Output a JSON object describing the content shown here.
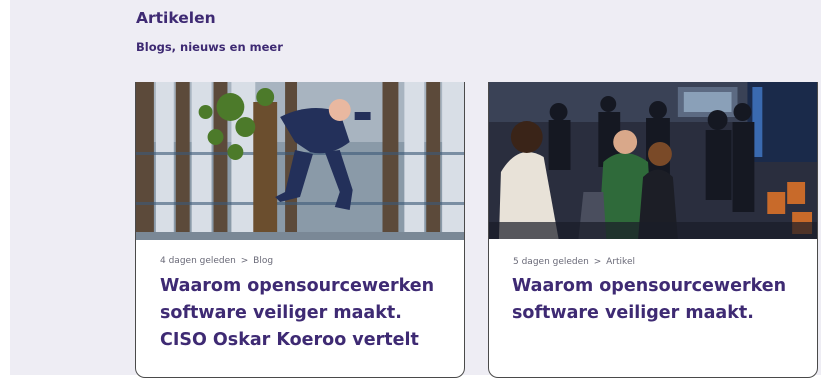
{
  "section": {
    "title": "Artikelen",
    "subtitle": "Blogs, nieuws en meer"
  },
  "cards": [
    {
      "date": "4 dagen geleden",
      "separator": ">",
      "category": "Blog",
      "title": "Waarom opensourcewerken software veiliger maakt. CISO Oskar Koeroo vertelt"
    },
    {
      "date": "5 dagen geleden",
      "separator": ">",
      "category": "Artikel",
      "title": "Waarom opensourcewerken software veiliger maakt."
    }
  ],
  "colors": {
    "panel_background": "#eeedf4",
    "heading": "#3e2a73",
    "meta_text": "#6a6a78",
    "card_border": "#4a4a4a"
  }
}
